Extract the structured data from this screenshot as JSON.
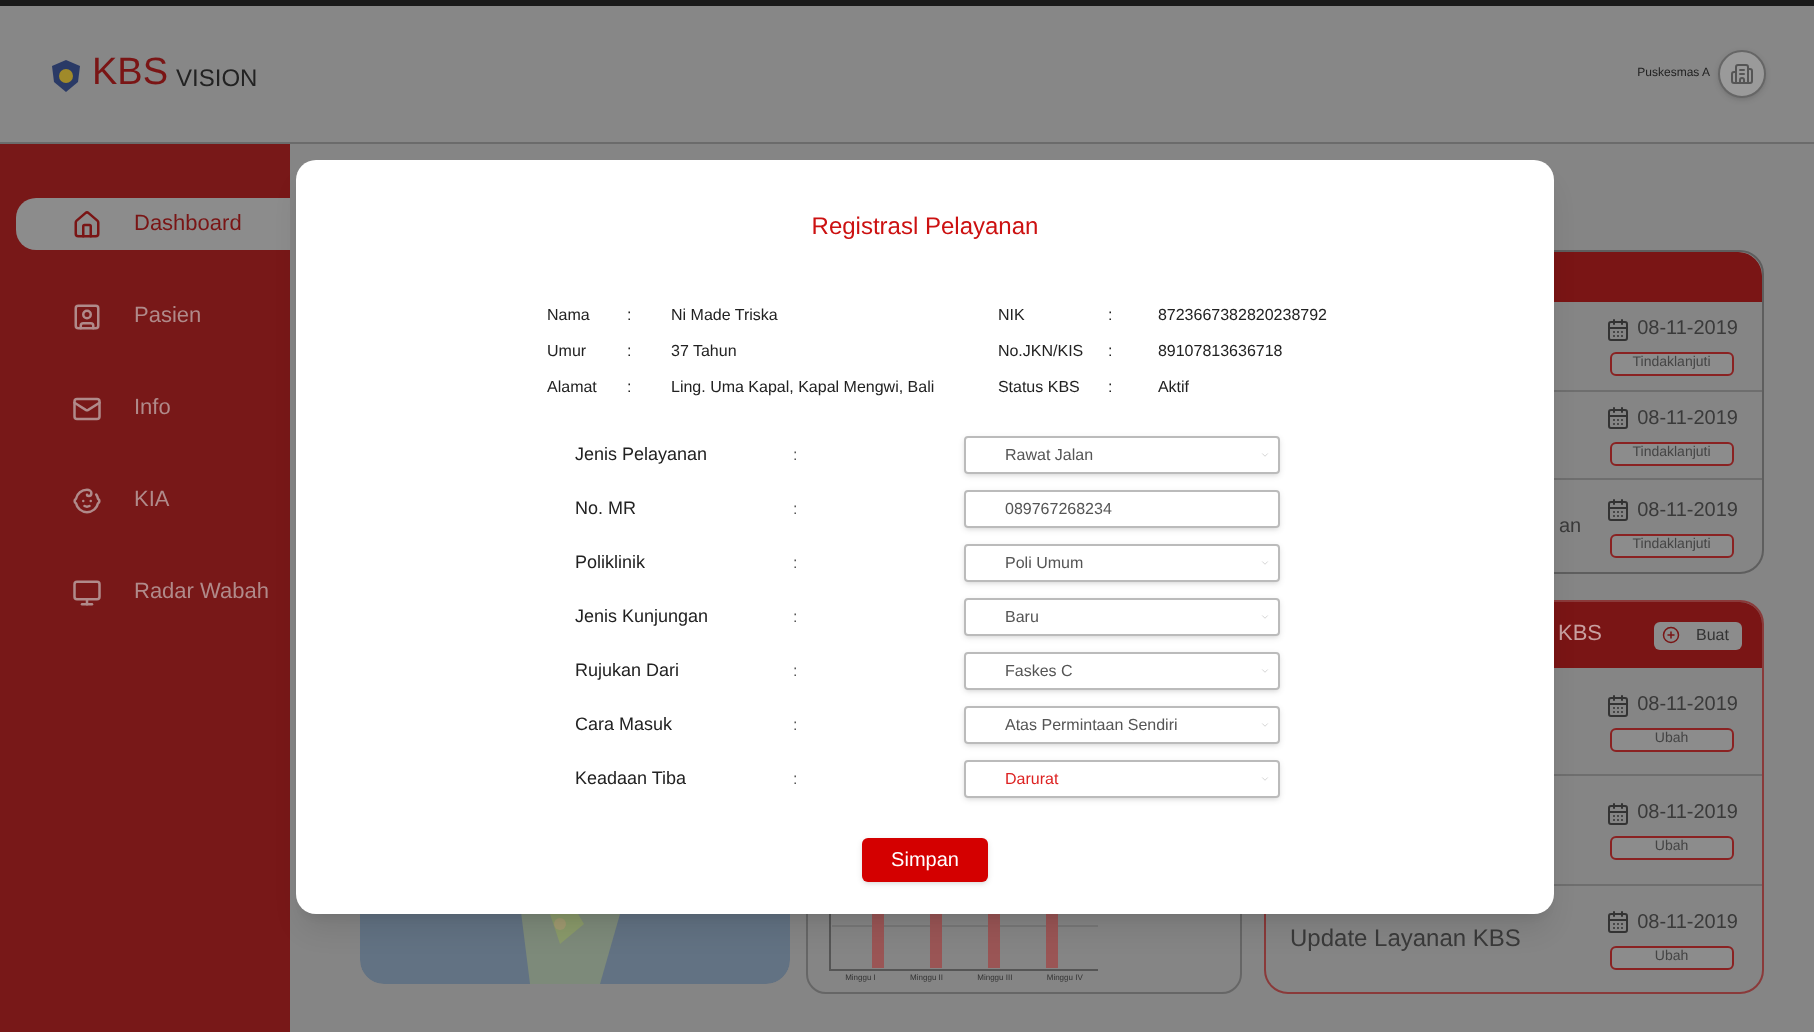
{
  "header": {
    "logo_main": "KBS",
    "logo_sub": "VISION",
    "facility": "Puskesmas A"
  },
  "sidebar": {
    "items": [
      {
        "label": "Dashboard",
        "selected": true
      },
      {
        "label": "Pasien",
        "selected": false
      },
      {
        "label": "Info",
        "selected": false
      },
      {
        "label": "KIA",
        "selected": false
      },
      {
        "label": "Radar Wabah",
        "selected": false
      }
    ]
  },
  "chart": {
    "x_labels": [
      "Minggu I",
      "Minggu II",
      "Minggu III",
      "Minggu IV"
    ]
  },
  "cards": [
    {
      "rows": [
        {
          "date": "08-11-2019",
          "action": "Tindaklanjuti"
        },
        {
          "date": "08-11-2019",
          "action": "Tindaklanjuti"
        },
        {
          "text": "an",
          "date": "08-11-2019",
          "action": "Tindaklanjuti"
        }
      ]
    },
    {
      "title": "KBS",
      "button": "Buat",
      "rows": [
        {
          "date": "08-11-2019",
          "action": "Ubah"
        },
        {
          "date": "08-11-2019",
          "action": "Ubah"
        },
        {
          "text": "Update Layanan KBS",
          "date": "08-11-2019",
          "action": "Ubah"
        }
      ]
    }
  ],
  "modal": {
    "title": "Registrasl Pelayanan",
    "info_left": [
      {
        "label": "Nama",
        "value": "Ni Made Triska"
      },
      {
        "label": "Umur",
        "value": "37 Tahun"
      },
      {
        "label": "Alamat",
        "value": "Ling. Uma Kapal, Kapal Mengwi, Bali"
      }
    ],
    "info_right": [
      {
        "label": "NIK",
        "value": "8723667382820238792"
      },
      {
        "label": "No.JKN/KIS",
        "value": "89107813636718"
      },
      {
        "label": "Status KBS",
        "value": "Aktif"
      }
    ],
    "fields": [
      {
        "label": "Jenis Pelayanan",
        "kind": "select",
        "value": "Rawat Jalan",
        "alert": false
      },
      {
        "label": "No. MR",
        "kind": "input",
        "value": "089767268234",
        "alert": false
      },
      {
        "label": "Poliklinik",
        "kind": "select",
        "value": "Poli Umum",
        "alert": false
      },
      {
        "label": "Jenis Kunjungan",
        "kind": "select",
        "value": "Baru",
        "alert": false
      },
      {
        "label": "Rujukan Dari",
        "kind": "select",
        "value": "Faskes C",
        "alert": false
      },
      {
        "label": "Cara Masuk",
        "kind": "select",
        "value": "Atas Permintaan Sendiri",
        "alert": false
      },
      {
        "label": "Keadaan Tiba",
        "kind": "select",
        "value": "Darurat",
        "alert": true
      }
    ],
    "sep": ":",
    "submit": "Simpan"
  }
}
